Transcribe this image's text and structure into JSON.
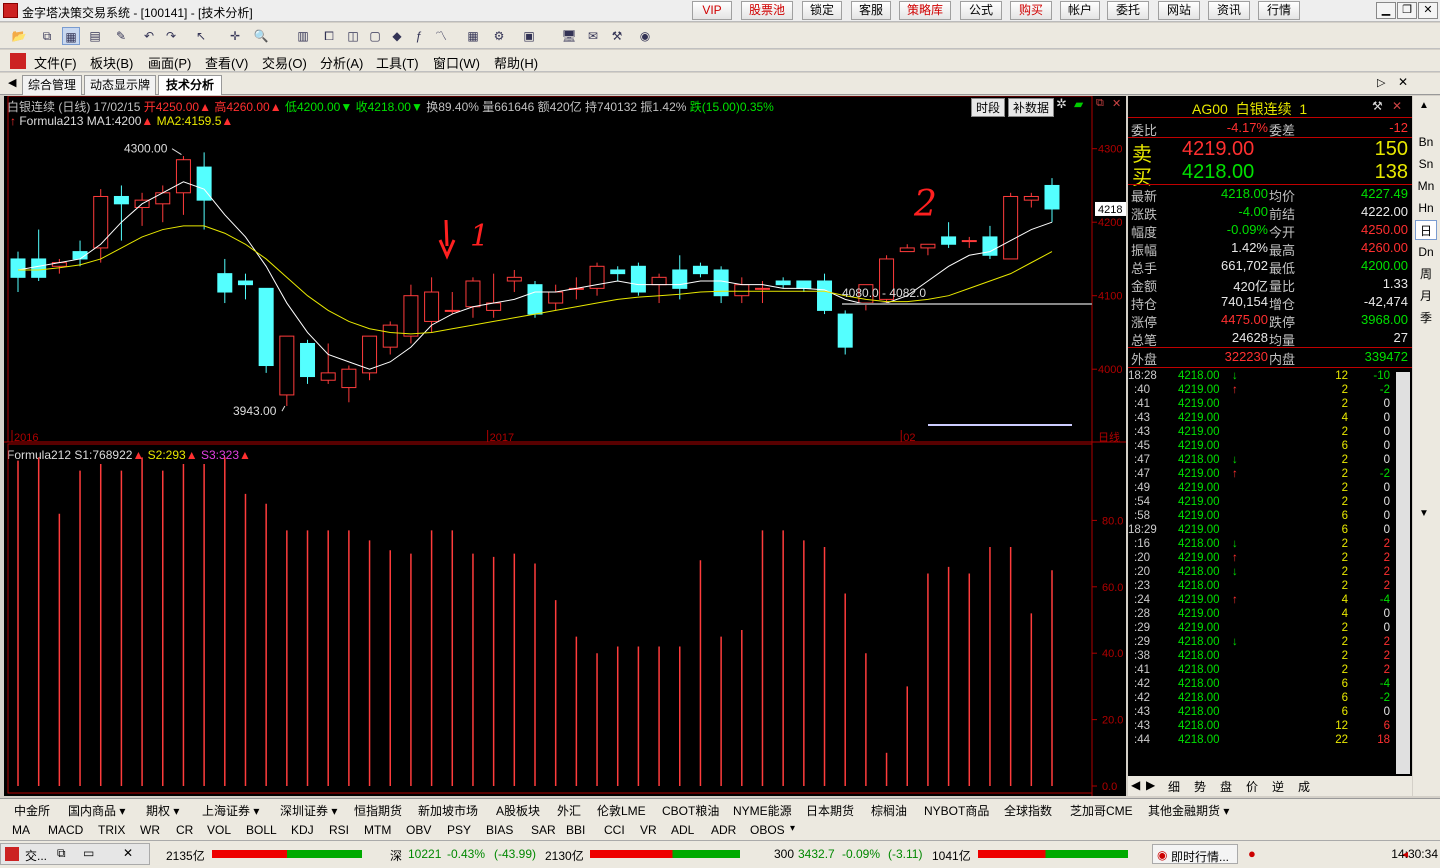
{
  "window": {
    "title": "金字塔决策交易系统 - [100141] - [技术分析]"
  },
  "topbuttons": [
    {
      "label": "VIP",
      "red": true
    },
    {
      "label": "股票池",
      "red": true
    },
    {
      "label": "锁定",
      "red": false
    },
    {
      "label": "客服",
      "red": false
    },
    {
      "label": "策略库",
      "red": true
    },
    {
      "label": "公式",
      "red": false
    },
    {
      "label": "购买",
      "red": true
    },
    {
      "label": "帐户",
      "red": false
    },
    {
      "label": "委托",
      "red": false
    },
    {
      "label": "网站",
      "red": false
    },
    {
      "label": "资讯",
      "red": false
    },
    {
      "label": "行情",
      "red": false
    }
  ],
  "menu": [
    "文件(F)",
    "板块(B)",
    "画面(P)",
    "查看(V)",
    "交易(O)",
    "分析(A)",
    "工具(T)",
    "窗口(W)",
    "帮助(H)"
  ],
  "tabs": [
    "综合管理",
    "动态显示牌",
    "技术分析"
  ],
  "chart": {
    "header": {
      "name": "白银连续 (日线) 17/02/15",
      "open": "开4250.00",
      "high": "高4260.00",
      "low": "低4200.00",
      "close": "收4218.00",
      "turnover": "换89.40%",
      "volume": "量661646",
      "amount": "额420亿",
      "position": "持740132",
      "amplitude": "振1.42%",
      "change": "跌(15.00)0.35%"
    },
    "buttons": {
      "period": "时段",
      "supplement": "补数据"
    },
    "formula1": "Formula213",
    "ma1": "MA1:4200",
    "ma2": "MA2:4159.5",
    "formula2": "Formula212",
    "s1": "S1:768922",
    "s2": "S2:293",
    "s3": "S3:323",
    "annot_high": "4300.00",
    "annot_low": "3943.00",
    "annot_range": "4080.0 - 4082.0",
    "marker_one": "1",
    "marker_two": "2",
    "price_tag": "4218",
    "yticks_price": [
      "4300",
      "4200",
      "4100",
      "4000"
    ],
    "yticks_ind": [
      "80.0",
      "60.0",
      "40.0",
      "20.0",
      "0.0"
    ],
    "xlabels": [
      "2016",
      "2017",
      "02"
    ],
    "period_label": "日线"
  },
  "chart_data": [
    {
      "type": "candlestick",
      "title": "白银连续 (日线)",
      "ylim": [
        3920,
        4320
      ],
      "candles": [
        [
          4150,
          4160,
          4105,
          4125
        ],
        [
          4150,
          4190,
          4120,
          4125
        ],
        [
          4140,
          4150,
          4130,
          4145
        ],
        [
          4160,
          4175,
          4140,
          4150
        ],
        [
          4165,
          4245,
          4145,
          4235
        ],
        [
          4235,
          4250,
          4175,
          4225
        ],
        [
          4220,
          4240,
          4195,
          4230
        ],
        [
          4225,
          4250,
          4200,
          4240
        ],
        [
          4240,
          4290,
          4210,
          4285
        ],
        [
          4275,
          4295,
          4190,
          4230
        ],
        [
          4130,
          4150,
          4090,
          4105
        ],
        [
          4120,
          4130,
          4095,
          4115
        ],
        [
          4110,
          4110,
          3995,
          4005
        ],
        [
          3965,
          4045,
          3950,
          4045
        ],
        [
          4035,
          4040,
          3980,
          3990
        ],
        [
          3985,
          4035,
          3980,
          3995
        ],
        [
          3975,
          4005,
          3955,
          4000
        ],
        [
          3995,
          4045,
          3985,
          4045
        ],
        [
          4030,
          4065,
          4020,
          4060
        ],
        [
          4045,
          4115,
          4035,
          4100
        ],
        [
          4065,
          4125,
          4050,
          4105
        ],
        [
          4080,
          4105,
          4075,
          4080
        ],
        [
          4085,
          4125,
          4070,
          4120
        ],
        [
          4080,
          4130,
          4070,
          4090
        ],
        [
          4120,
          4135,
          4105,
          4125
        ],
        [
          4115,
          4120,
          4070,
          4075
        ],
        [
          4090,
          4115,
          4080,
          4105
        ],
        [
          4110,
          4125,
          4095,
          4110
        ],
        [
          4110,
          4145,
          4100,
          4140
        ],
        [
          4135,
          4140,
          4120,
          4130
        ],
        [
          4140,
          4145,
          4100,
          4105
        ],
        [
          4115,
          4130,
          4090,
          4125
        ],
        [
          4135,
          4155,
          4095,
          4110
        ],
        [
          4140,
          4145,
          4125,
          4130
        ],
        [
          4135,
          4140,
          4090,
          4100
        ],
        [
          4100,
          4125,
          4090,
          4115
        ],
        [
          4110,
          4120,
          4090,
          4110
        ],
        [
          4120,
          4125,
          4110,
          4115
        ],
        [
          4120,
          4120,
          4105,
          4110
        ],
        [
          4120,
          4130,
          4075,
          4080
        ],
        [
          4075,
          4080,
          4020,
          4030
        ],
        [
          4090,
          4115,
          4080,
          4115
        ],
        [
          4095,
          4155,
          4090,
          4150
        ],
        [
          4160,
          4170,
          4160,
          4165
        ],
        [
          4165,
          4170,
          4155,
          4170
        ],
        [
          4180,
          4200,
          4165,
          4170
        ],
        [
          4175,
          4180,
          4165,
          4175
        ],
        [
          4180,
          4195,
          4150,
          4155
        ],
        [
          4150,
          4240,
          4150,
          4235
        ],
        [
          4230,
          4240,
          4220,
          4235
        ],
        [
          4250,
          4260,
          4200,
          4218
        ]
      ],
      "ma1": [
        4135,
        4140,
        4145,
        4150,
        4170,
        4200,
        4225,
        4240,
        4255,
        4245,
        4210,
        4180,
        4140,
        4090,
        4050,
        4020,
        4010,
        4000,
        4010,
        4030,
        4060,
        4075,
        4085,
        4090,
        4095,
        4105,
        4105,
        4110,
        4115,
        4120,
        4115,
        4115,
        4115,
        4120,
        4120,
        4115,
        4115,
        4110,
        4110,
        4108,
        4095,
        4088,
        4090,
        4100,
        4120,
        4140,
        4155,
        4160,
        4175,
        4190,
        4200
      ],
      "ma2": [
        4135,
        4135,
        4138,
        4142,
        4150,
        4165,
        4180,
        4190,
        4195,
        4195,
        4185,
        4170,
        4150,
        4125,
        4100,
        4080,
        4065,
        4055,
        4050,
        4048,
        4050,
        4055,
        4060,
        4065,
        4070,
        4075,
        4080,
        4085,
        4090,
        4095,
        4098,
        4100,
        4102,
        4105,
        4106,
        4106,
        4106,
        4106,
        4106,
        4106,
        4100,
        4095,
        4092,
        4092,
        4095,
        4100,
        4110,
        4120,
        4130,
        4145,
        4160
      ]
    },
    {
      "type": "bar",
      "title": "Formula212",
      "ylim": [
        0,
        100
      ],
      "values": [
        98,
        99,
        82,
        95,
        97,
        95,
        99,
        95,
        97,
        97,
        99,
        88,
        85,
        77,
        77,
        77,
        77,
        74,
        71,
        70,
        77,
        77,
        70,
        69,
        70,
        67,
        56,
        45,
        40,
        42,
        42,
        42,
        42,
        68,
        45,
        47,
        77,
        77,
        74,
        72,
        58,
        40,
        10,
        30,
        64,
        66,
        64,
        72,
        72,
        52,
        65
      ]
    }
  ],
  "quote": {
    "code": "AG00",
    "name": "白银连续",
    "suffix": "1",
    "rows": [
      {
        "l1": "委比",
        "v1": "-4.17%",
        "c1": "red",
        "l2": "委差",
        "v2": "-12",
        "c2": "red"
      }
    ],
    "sell_label": "卖",
    "sell_price": "4219.00",
    "sell_vol": "150",
    "buy_label": "买",
    "buy_price": "4218.00",
    "buy_vol": "138",
    "stats": [
      {
        "l1": "最新",
        "v1": "4218.00",
        "c1": "grn",
        "l2": "均价",
        "v2": "4227.49",
        "c2": "grn"
      },
      {
        "l1": "涨跌",
        "v1": "-4.00",
        "c1": "grn",
        "l2": "前结",
        "v2": "4222.00",
        "c2": "wht"
      },
      {
        "l1": "幅度",
        "v1": "-0.09%",
        "c1": "grn",
        "l2": "今开",
        "v2": "4250.00",
        "c2": "red"
      },
      {
        "l1": "振幅",
        "v1": "1.42%",
        "c1": "wht",
        "l2": "最高",
        "v2": "4260.00",
        "c2": "red"
      },
      {
        "l1": "总手",
        "v1": "661,702",
        "c1": "wht",
        "l2": "最低",
        "v2": "4200.00",
        "c2": "grn"
      },
      {
        "l1": "金额",
        "v1": "420亿",
        "c1": "wht",
        "l2": "量比",
        "v2": "1.33",
        "c2": "wht"
      },
      {
        "l1": "持仓",
        "v1": "740,154",
        "c1": "wht",
        "l2": "增仓",
        "v2": "-42,474",
        "c2": "wht"
      },
      {
        "l1": "涨停",
        "v1": "4475.00",
        "c1": "red",
        "l2": "跌停",
        "v2": "3968.00",
        "c2": "grn"
      },
      {
        "l1": "总笔",
        "v1": "24628",
        "c1": "wht",
        "l2": "均量",
        "v2": "27",
        "c2": "wht"
      }
    ],
    "outer_label": "外盘",
    "outer_val": "322230",
    "inner_label": "内盘",
    "inner_val": "339472",
    "ticks": [
      {
        "t": "18:28",
        "p": "4218.00",
        "a": "↓",
        "ac": "grn",
        "v": "12",
        "d": "-10",
        "dc": "grn"
      },
      {
        "t": ":40",
        "p": "4219.00",
        "a": "↑",
        "ac": "red",
        "v": "2",
        "d": "-2",
        "dc": "grn"
      },
      {
        "t": ":41",
        "p": "4219.00",
        "a": "",
        "ac": "",
        "v": "2",
        "d": "0",
        "dc": "wht"
      },
      {
        "t": ":43",
        "p": "4219.00",
        "a": "",
        "ac": "",
        "v": "4",
        "d": "0",
        "dc": "wht"
      },
      {
        "t": ":43",
        "p": "4219.00",
        "a": "",
        "ac": "",
        "v": "2",
        "d": "0",
        "dc": "wht"
      },
      {
        "t": ":45",
        "p": "4219.00",
        "a": "",
        "ac": "",
        "v": "6",
        "d": "0",
        "dc": "wht"
      },
      {
        "t": ":47",
        "p": "4218.00",
        "a": "↓",
        "ac": "grn",
        "v": "2",
        "d": "0",
        "dc": "wht"
      },
      {
        "t": ":47",
        "p": "4219.00",
        "a": "↑",
        "ac": "red",
        "v": "2",
        "d": "-2",
        "dc": "grn"
      },
      {
        "t": ":49",
        "p": "4219.00",
        "a": "",
        "ac": "",
        "v": "2",
        "d": "0",
        "dc": "wht"
      },
      {
        "t": ":54",
        "p": "4219.00",
        "a": "",
        "ac": "",
        "v": "2",
        "d": "0",
        "dc": "wht"
      },
      {
        "t": ":58",
        "p": "4219.00",
        "a": "",
        "ac": "",
        "v": "6",
        "d": "0",
        "dc": "wht"
      },
      {
        "t": "18:29",
        "p": "4219.00",
        "a": "",
        "ac": "",
        "v": "6",
        "d": "0",
        "dc": "wht"
      },
      {
        "t": ":16",
        "p": "4218.00",
        "a": "↓",
        "ac": "grn",
        "v": "2",
        "d": "2",
        "dc": "red"
      },
      {
        "t": ":20",
        "p": "4219.00",
        "a": "↑",
        "ac": "red",
        "v": "2",
        "d": "2",
        "dc": "red"
      },
      {
        "t": ":20",
        "p": "4218.00",
        "a": "↓",
        "ac": "grn",
        "v": "2",
        "d": "2",
        "dc": "red"
      },
      {
        "t": ":23",
        "p": "4218.00",
        "a": "",
        "ac": "",
        "v": "2",
        "d": "2",
        "dc": "red"
      },
      {
        "t": ":24",
        "p": "4219.00",
        "a": "↑",
        "ac": "red",
        "v": "4",
        "d": "-4",
        "dc": "grn"
      },
      {
        "t": ":28",
        "p": "4219.00",
        "a": "",
        "ac": "",
        "v": "4",
        "d": "0",
        "dc": "wht"
      },
      {
        "t": ":29",
        "p": "4219.00",
        "a": "",
        "ac": "",
        "v": "2",
        "d": "0",
        "dc": "wht"
      },
      {
        "t": ":29",
        "p": "4218.00",
        "a": "↓",
        "ac": "grn",
        "v": "2",
        "d": "2",
        "dc": "red"
      },
      {
        "t": ":38",
        "p": "4218.00",
        "a": "",
        "ac": "",
        "v": "2",
        "d": "2",
        "dc": "red"
      },
      {
        "t": ":41",
        "p": "4218.00",
        "a": "",
        "ac": "",
        "v": "2",
        "d": "2",
        "dc": "red"
      },
      {
        "t": ":42",
        "p": "4218.00",
        "a": "",
        "ac": "",
        "v": "6",
        "d": "-4",
        "dc": "grn"
      },
      {
        "t": ":42",
        "p": "4218.00",
        "a": "",
        "ac": "",
        "v": "6",
        "d": "-2",
        "dc": "grn"
      },
      {
        "t": ":43",
        "p": "4218.00",
        "a": "",
        "ac": "",
        "v": "6",
        "d": "0",
        "dc": "wht"
      },
      {
        "t": ":43",
        "p": "4218.00",
        "a": "",
        "ac": "",
        "v": "12",
        "d": "6",
        "dc": "red"
      },
      {
        "t": ":44",
        "p": "4218.00",
        "a": "",
        "ac": "",
        "v": "22",
        "d": "18",
        "dc": "red"
      }
    ],
    "bottom_tabs": [
      "细",
      "势",
      "盘",
      "价",
      "逆",
      "成"
    ]
  },
  "side": [
    "Bn",
    "Sn",
    "Mn",
    "Hn",
    "日",
    "Dn",
    "周",
    "月",
    "季"
  ],
  "bottomtabs": [
    "中金所",
    "国内商品 ▾",
    "期权 ▾",
    "上海证券 ▾",
    "深圳证券 ▾",
    "恒指期货",
    "新加坡市场",
    "A股板块",
    "外汇",
    "伦敦LME",
    "CBOT粮油",
    "NYME能源",
    "日本期货",
    "棕榈油",
    "NYBOT商品",
    "全球指数",
    "芝加哥CME",
    "其他金融期货 ▾"
  ],
  "indicators": [
    "MA",
    "MACD",
    "TRIX",
    "WR",
    "CR",
    "VOL",
    "BOLL",
    "KDJ",
    "RSI",
    "MTM",
    "OBV",
    "PSY",
    "BIAS",
    "SAR",
    "BBI",
    "CCI",
    "VR",
    "ADL",
    "ADR",
    "OBOS"
  ],
  "status": {
    "task": "交...",
    "amt1": "2135亿",
    "shen": "深",
    "shen_val": "10221",
    "shen_pct": "-0.43%",
    "shen_chg": "(-43.99)",
    "amt2": "2130亿",
    "idx300": "300",
    "idx300_val": "3432.7",
    "idx300_pct": "-0.09%",
    "idx300_chg": "(-3.11)",
    "amt3": "1041亿",
    "live": "即时行情...",
    "time": "14:30:34"
  }
}
